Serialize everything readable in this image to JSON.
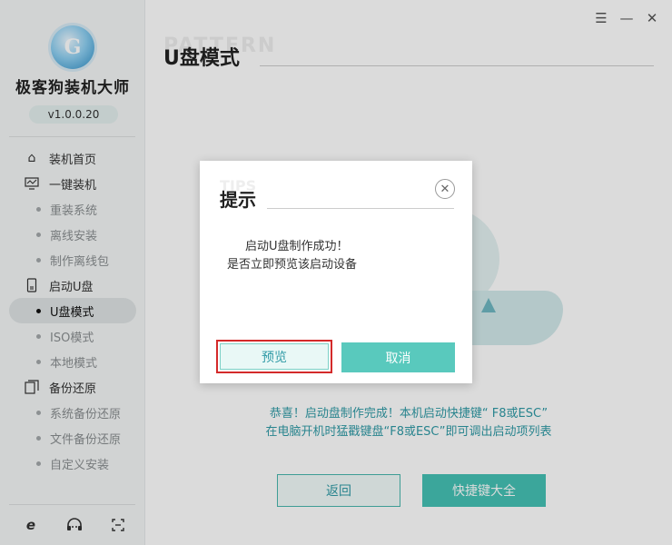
{
  "app": {
    "name": "极客狗装机大师",
    "version": "v1.0.0.20",
    "logo_letter": "G"
  },
  "sidebar": {
    "items": [
      {
        "label": "装机首页",
        "icon": "home-icon",
        "type": "main"
      },
      {
        "label": "一键装机",
        "icon": "monitor-icon",
        "type": "main"
      },
      {
        "label": "重装系统",
        "type": "sub"
      },
      {
        "label": "离线安装",
        "type": "sub"
      },
      {
        "label": "制作离线包",
        "type": "sub"
      },
      {
        "label": "启动U盘",
        "icon": "usb-drive-icon",
        "type": "main"
      },
      {
        "label": "U盘模式",
        "type": "sub",
        "active": true
      },
      {
        "label": "ISO模式",
        "type": "sub"
      },
      {
        "label": "本地模式",
        "type": "sub"
      },
      {
        "label": "备份还原",
        "icon": "backup-icon",
        "type": "main"
      },
      {
        "label": "系统备份还原",
        "type": "sub"
      },
      {
        "label": "文件备份还原",
        "type": "sub"
      },
      {
        "label": "自定义安装",
        "type": "sub"
      }
    ],
    "bottom_icons": [
      "ie-browser-icon",
      "headset-support-icon",
      "screenshot-icon"
    ]
  },
  "window_controls": {
    "menu": "☰",
    "minimize": "—",
    "close": "✕"
  },
  "main": {
    "title": "U盘模式",
    "title_watermark": "PATTERN",
    "info_line1": "恭喜！启动盘制作完成！本机启动快捷键“ F8或ESC”",
    "info_line2": "在电脑开机时猛戳键盘“F8或ESC”即可调出启动项列表",
    "back_button": "返回",
    "hotkey_button": "快捷键大全"
  },
  "dialog": {
    "title": "提示",
    "title_watermark": "TIPS",
    "message_line1": "启动U盘制作成功！",
    "message_line2": "是否立即预览该启动设备",
    "preview_button": "预览",
    "cancel_button": "取消",
    "close_symbol": "✕"
  },
  "colors": {
    "accent": "#45c2b5",
    "accent_text": "#2f9aa6",
    "highlight_border": "#d42a2a"
  }
}
